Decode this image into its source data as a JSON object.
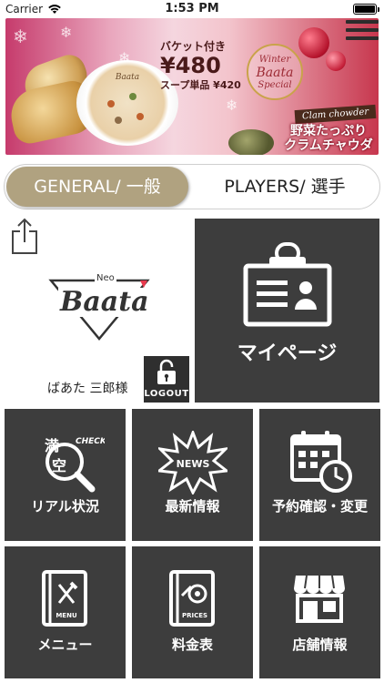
{
  "status_bar": {
    "carrier": "Carrier",
    "time": "1:53 PM",
    "battery_level": 1.0
  },
  "banner": {
    "price_label": "バケット付き",
    "price_main": "¥480",
    "price_sub": "スープ単品 ¥420",
    "special_line1": "Winter",
    "special_line2": "Baata",
    "special_line3": "Special",
    "dish_tag": "Clam chowder",
    "dish_name_line1": "野菜たっぷり",
    "dish_name_line2": "クラムチャウダー",
    "bowl_logo": "Baata"
  },
  "menu_button": {
    "icon": "hamburger-icon"
  },
  "segmented": {
    "general": "GENERAL/ 一般",
    "players": "PLAYERS/ 選手",
    "selected": "general"
  },
  "share": {
    "icon": "share-icon"
  },
  "logo": {
    "top": "Neo",
    "main": "Baata"
  },
  "user": {
    "name": "ばあた 三郎様"
  },
  "logout": {
    "label": "LOGOUT",
    "icon": "unlock-icon"
  },
  "tiles": {
    "mypage": {
      "label": "マイページ",
      "icon": "id-card-icon"
    },
    "real_status": {
      "label": "リアル状況",
      "icon": "magnifier-check-icon",
      "char1": "満",
      "char2": "空",
      "check": "CHECK!"
    },
    "news": {
      "label": "最新情報",
      "icon": "news-burst-icon",
      "badge": "NEWS"
    },
    "reservation": {
      "label": "予約確認・変更",
      "icon": "calendar-clock-icon"
    },
    "menu": {
      "label": "メニュー",
      "icon": "menu-book-icon",
      "book_text": "MENU"
    },
    "prices": {
      "label": "料金表",
      "icon": "price-book-icon",
      "book_text": "PRICES"
    },
    "store": {
      "label": "店舗情報",
      "icon": "store-icon"
    }
  },
  "colors": {
    "tile_bg": "#3d3d3d",
    "segment_selected": "#b0a280",
    "logo_accent": "#e83a4e"
  }
}
